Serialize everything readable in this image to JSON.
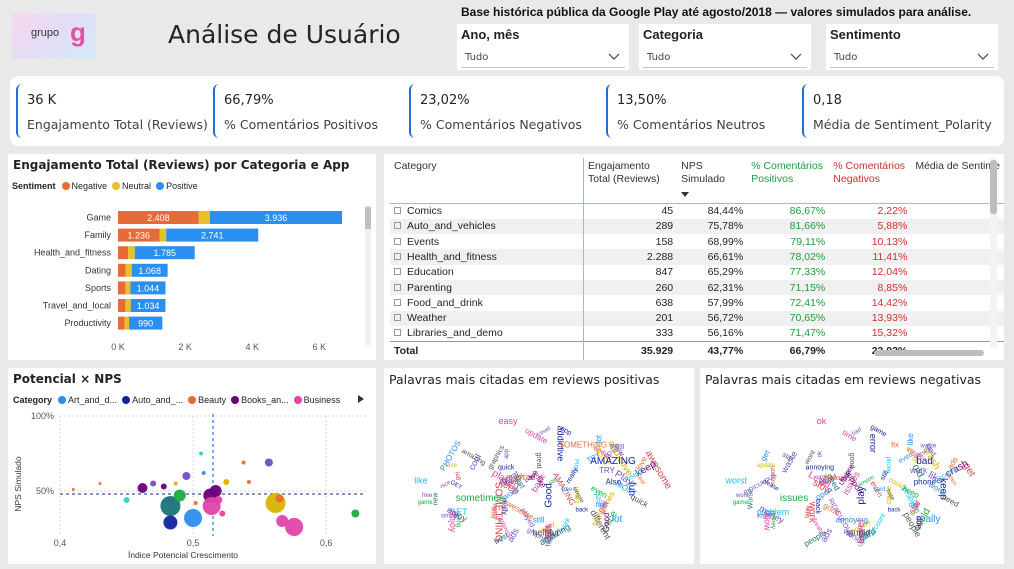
{
  "header": {
    "logo_text": "grupo",
    "logo_mark": "g",
    "title": "Análise de Usuário",
    "note": "Base histórica pública da Google Play até agosto/2018 — valores simulados para análise."
  },
  "slicers": [
    {
      "title": "Ano, mês",
      "value": "Tudo"
    },
    {
      "title": "Categoria",
      "value": "Tudo"
    },
    {
      "title": "Sentimento",
      "value": "Tudo"
    }
  ],
  "kpis": [
    {
      "value": "36 K",
      "label": "Engajamento Total (Reviews)"
    },
    {
      "value": "66,79%",
      "label": "% Comentários Positivos"
    },
    {
      "value": "23,02%",
      "label": "% Comentários Negativos"
    },
    {
      "value": "13,50%",
      "label": "% Comentários Neutros"
    },
    {
      "value": "0,18",
      "label": "Média de Sentiment_Polarity"
    }
  ],
  "bar_panel": {
    "title": "Engajamento Total (Reviews) por Categoria e App",
    "legend_title": "Sentiment",
    "legend": [
      {
        "name": "Negative",
        "color": "#e66c37"
      },
      {
        "name": "Neutral",
        "color": "#e8c02c"
      },
      {
        "name": "Positive",
        "color": "#2b8ff0"
      }
    ]
  },
  "table": {
    "columns": [
      "Category",
      "Engajamento Total (Reviews)",
      "NPS Simulado",
      "% Comentários Positivos",
      "% Comentários Negativos",
      "Média de Sentime"
    ],
    "rows": [
      {
        "category": "Comics",
        "eng": "45",
        "nps": "84,44%",
        "pos": "86,67%",
        "neg": "2,22%"
      },
      {
        "category": "Auto_and_vehicles",
        "eng": "289",
        "nps": "75,78%",
        "pos": "81,66%",
        "neg": "5,88%"
      },
      {
        "category": "Events",
        "eng": "158",
        "nps": "68,99%",
        "pos": "79,11%",
        "neg": "10,13%"
      },
      {
        "category": "Health_and_fitness",
        "eng": "2.288",
        "nps": "66,61%",
        "pos": "78,02%",
        "neg": "11,41%"
      },
      {
        "category": "Education",
        "eng": "847",
        "nps": "65,29%",
        "pos": "77,33%",
        "neg": "12,04%"
      },
      {
        "category": "Parenting",
        "eng": "260",
        "nps": "62,31%",
        "pos": "71,15%",
        "neg": "8,85%"
      },
      {
        "category": "Food_and_drink",
        "eng": "638",
        "nps": "57,99%",
        "pos": "72,41%",
        "neg": "14,42%"
      },
      {
        "category": "Weather",
        "eng": "201",
        "nps": "56,72%",
        "pos": "70,65%",
        "neg": "13,93%"
      },
      {
        "category": "Libraries_and_demo",
        "eng": "333",
        "nps": "56,16%",
        "pos": "71,47%",
        "neg": "15,32%"
      }
    ],
    "total": {
      "category": "Total",
      "eng": "35.929",
      "nps": "43,77%",
      "pos": "66,79%",
      "neg": "23,02%"
    }
  },
  "scatter_panel": {
    "title": "Potencial × NPS",
    "legend_title": "Category",
    "legend": [
      {
        "name": "Art_and_d...",
        "color": "#2b8ff0"
      },
      {
        "name": "Auto_and_...",
        "color": "#12239e"
      },
      {
        "name": "Beauty",
        "color": "#e66c37"
      },
      {
        "name": "Books_an...",
        "color": "#6b007b"
      },
      {
        "name": "Business",
        "color": "#e044a7"
      }
    ]
  },
  "wordcloud_pos": {
    "title": "Palavras mais citadas em reviews positivas",
    "words": [
      "nice",
      "played",
      "ads",
      "love",
      "Good",
      "game",
      "app",
      "easy",
      "time",
      "update",
      "Level",
      "AMAZING",
      "TRY",
      "SOMETHING",
      "great",
      "awesome",
      "PHOTOS",
      "GET",
      "Also",
      "Play",
      "lot",
      "different",
      "best",
      "fun",
      "even",
      "really",
      "back",
      "sometimes",
      "new",
      "graphics",
      "free",
      "amazing",
      "get",
      "like",
      "MOST",
      "addictive",
      "keep",
      "enjoy",
      "going",
      "cool",
      "work",
      "useful",
      "helpful",
      "simple",
      "LOVE",
      "still",
      "quick",
      "fast"
    ]
  },
  "wordcloud_neg": {
    "title": "Palavras mais citadas em reviews negativas",
    "words": [
      "RIDICULOUS",
      "Level",
      "ads",
      "app",
      "play",
      "game",
      "ok",
      "update",
      "time",
      "cause",
      "bad",
      "even",
      "work",
      "fix",
      "good",
      "get",
      "please",
      "problem",
      "phone",
      "like",
      "really",
      "people",
      "Update",
      "keep",
      "still",
      "back",
      "issues",
      "load",
      "Worse",
      "wont",
      "card",
      "star",
      "support",
      "worst",
      "error",
      "crash",
      "slow",
      "money",
      "waste",
      "open",
      "account",
      "stupid",
      "hate",
      "login",
      "version",
      "annoying",
      "need",
      "old",
      "could"
    ]
  },
  "chart_data": [
    {
      "type": "bar",
      "orientation": "horizontal",
      "stacked": true,
      "title": "Engajamento Total (Reviews) por Categoria e App",
      "categories": [
        "Game",
        "Family",
        "Health_and_fitness",
        "Dating",
        "Sports",
        "Travel_and_local",
        "Productivity"
      ],
      "series": [
        {
          "name": "Negative",
          "values": [
            2408,
            1236,
            300,
            230,
            220,
            220,
            200
          ]
        },
        {
          "name": "Neutral",
          "values": [
            330,
            200,
            200,
            180,
            150,
            160,
            130
          ]
        },
        {
          "name": "Positive",
          "values": [
            3936,
            2741,
            1785,
            1068,
            1044,
            1034,
            990
          ]
        }
      ],
      "data_labels": {
        "Negative": [
          "2.408",
          "1.236",
          "",
          "",
          "",
          "",
          ""
        ],
        "Neutral": [
          "",
          "",
          "",
          "",
          "",
          "",
          ""
        ],
        "Positive": [
          "3.936",
          "2.741",
          "1.785",
          "1.068",
          "1.044",
          "1.034",
          "990"
        ]
      },
      "xlim": [
        0,
        7000
      ],
      "xticks": [
        0,
        2000,
        4000,
        6000
      ],
      "xtick_labels": [
        "0 K",
        "2 K",
        "4 K",
        "6 K"
      ]
    },
    {
      "type": "scatter",
      "title": "Potencial × NPS",
      "xlabel": "Índice Potencial Crescimento",
      "ylabel": "NPS Simulado",
      "xlim": [
        0.4,
        0.63
      ],
      "ylim": [
        0.2,
        1.0
      ],
      "xticks": [
        0.4,
        0.5,
        0.6
      ],
      "xtick_labels": [
        "0,4",
        "0,5",
        "0,6"
      ],
      "yticks": [
        0.5,
        1.0
      ],
      "ytick_labels": [
        "50%",
        "100%"
      ],
      "x_ref": 0.515,
      "y_ref": 0.48,
      "points": [
        {
          "x": 0.41,
          "y": 0.51,
          "r": 1.5,
          "color": "#e66c37"
        },
        {
          "x": 0.43,
          "y": 0.55,
          "r": 1.5,
          "color": "#e66c37"
        },
        {
          "x": 0.45,
          "y": 0.44,
          "r": 3,
          "color": "#2bd4c5"
        },
        {
          "x": 0.462,
          "y": 0.52,
          "r": 5,
          "color": "#6b007b"
        },
        {
          "x": 0.47,
          "y": 0.55,
          "r": 3,
          "color": "#744ec2"
        },
        {
          "x": 0.478,
          "y": 0.53,
          "r": 3,
          "color": "#6b007b"
        },
        {
          "x": 0.483,
          "y": 0.4,
          "r": 10,
          "color": "#197278"
        },
        {
          "x": 0.483,
          "y": 0.29,
          "r": 7,
          "color": "#12239e"
        },
        {
          "x": 0.487,
          "y": 0.55,
          "r": 2,
          "color": "#d9b300"
        },
        {
          "x": 0.49,
          "y": 0.47,
          "r": 6,
          "color": "#1aab40"
        },
        {
          "x": 0.495,
          "y": 0.6,
          "r": 4,
          "color": "#744ec2"
        },
        {
          "x": 0.5,
          "y": 0.32,
          "r": 9,
          "color": "#2b8ff0"
        },
        {
          "x": 0.502,
          "y": 0.42,
          "r": 2,
          "color": "#e66c37"
        },
        {
          "x": 0.506,
          "y": 0.75,
          "r": 2,
          "color": "#2bd4c5"
        },
        {
          "x": 0.508,
          "y": 0.62,
          "r": 2,
          "color": "#2b8ff0"
        },
        {
          "x": 0.513,
          "y": 0.47,
          "r": 7,
          "color": "#6b007b"
        },
        {
          "x": 0.514,
          "y": 0.4,
          "r": 9,
          "color": "#e044a7"
        },
        {
          "x": 0.517,
          "y": 0.5,
          "r": 6,
          "color": "#6b007b"
        },
        {
          "x": 0.519,
          "y": 0.44,
          "r": 4,
          "color": "#e044a7"
        },
        {
          "x": 0.522,
          "y": 0.35,
          "r": 3,
          "color": "#ea4397"
        },
        {
          "x": 0.525,
          "y": 0.56,
          "r": 3,
          "color": "#d9b300"
        },
        {
          "x": 0.538,
          "y": 0.69,
          "r": 2,
          "color": "#e66c37"
        },
        {
          "x": 0.542,
          "y": 0.56,
          "r": 2,
          "color": "#e66c37"
        },
        {
          "x": 0.557,
          "y": 0.69,
          "r": 4,
          "color": "#744ec2"
        },
        {
          "x": 0.562,
          "y": 0.42,
          "r": 10,
          "color": "#d9b300"
        },
        {
          "x": 0.565,
          "y": 0.45,
          "r": 4,
          "color": "#e66c37"
        },
        {
          "x": 0.567,
          "y": 0.3,
          "r": 6,
          "color": "#e044a7"
        },
        {
          "x": 0.576,
          "y": 0.26,
          "r": 9,
          "color": "#e044a7"
        },
        {
          "x": 0.622,
          "y": 0.35,
          "r": 4,
          "color": "#1aab40"
        }
      ]
    }
  ]
}
